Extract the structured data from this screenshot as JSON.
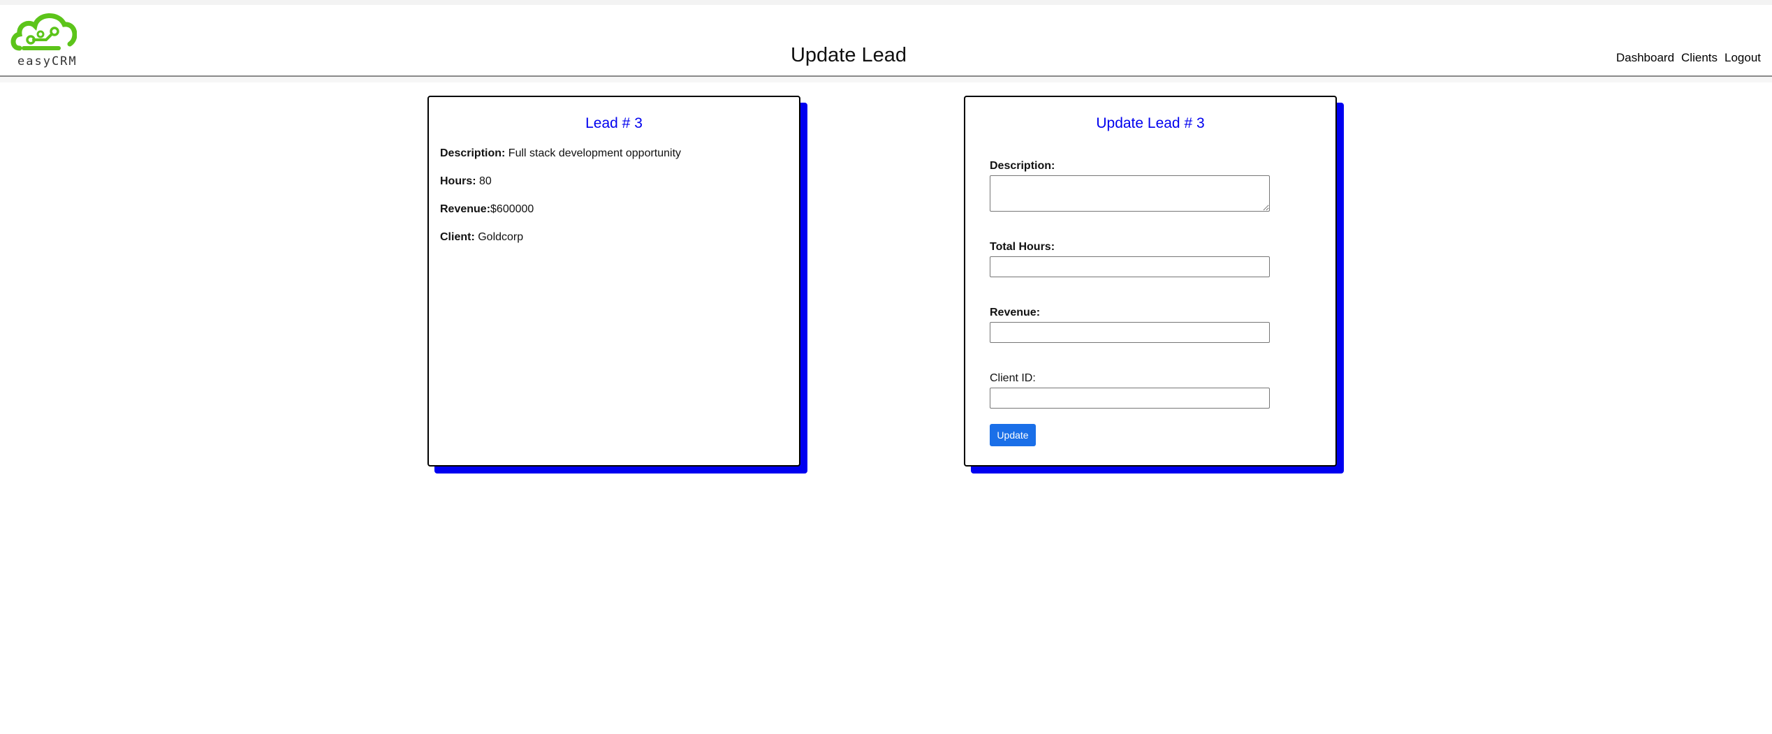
{
  "brand": {
    "logo_text": "easyCRM",
    "logo_color": "#5cc41a"
  },
  "header": {
    "title": "Update Lead"
  },
  "nav": {
    "items": [
      "Dashboard",
      "Clients",
      "Logout"
    ]
  },
  "lead_card": {
    "title": "Lead # 3",
    "fields": [
      {
        "label": "Description:",
        "value": "Full stack development opportunity"
      },
      {
        "label": "Hours:",
        "value": "80"
      },
      {
        "label": "Revenue:",
        "value": "$600000"
      },
      {
        "label": "Client:",
        "value": "Goldcorp"
      }
    ]
  },
  "form_card": {
    "title": "Update Lead # 3",
    "description_label": "Description:",
    "description_value": "",
    "hours_label": "Total Hours:",
    "hours_value": "",
    "revenue_label": "Revenue:",
    "revenue_value": "",
    "client_label": "Client ID:",
    "client_value": "",
    "submit_label": "Update"
  },
  "colors": {
    "accent": "#0000ee",
    "shadow": "#0000f0",
    "button": "#1a6fe8"
  }
}
